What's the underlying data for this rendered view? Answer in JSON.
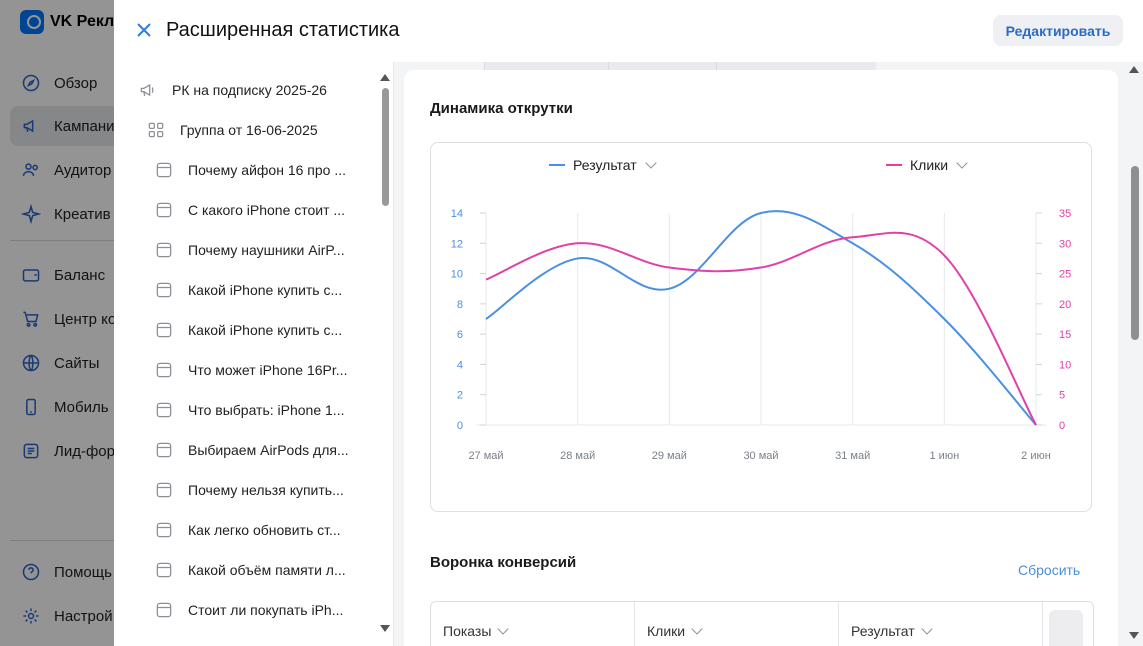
{
  "app": {
    "name": "VK Рекл",
    "nav": [
      {
        "label": "Обзор",
        "icon": "compass-icon"
      },
      {
        "label": "Кампани",
        "icon": "megaphone-icon",
        "active": true
      },
      {
        "label": "Аудитор",
        "icon": "users-icon"
      },
      {
        "label": "Креатив",
        "icon": "sparkle-icon"
      },
      {
        "label": "Баланс",
        "icon": "wallet-icon"
      },
      {
        "label": "Центр ко",
        "icon": "cart-icon"
      },
      {
        "label": "Сайты",
        "icon": "globe-icon"
      },
      {
        "label": "Мобиль",
        "icon": "phone-icon"
      },
      {
        "label": "Лид-фор",
        "icon": "list-icon"
      },
      {
        "label": "Помощь",
        "icon": "help-icon"
      },
      {
        "label": "Настрой",
        "icon": "settings-icon"
      }
    ]
  },
  "panel": {
    "title": "Расширенная статистика",
    "edit_label": "Редактировать"
  },
  "tree": {
    "campaign": "РК на подписку 2025-26",
    "group": "Группа от 16-06-2025",
    "ads": [
      "Почему айфон 16 про ...",
      "С какого iPhone стоит ...",
      "Почему наушники AirP...",
      "Какой iPhone купить с...",
      "Какой iPhone купить с...",
      "Что может iPhone 16Pr...",
      "Что выбрать: iPhone 1...",
      "Выбираем AirPods для...",
      "Почему нельзя купить...",
      "Как легко обновить ст...",
      "Какой объём памяти л...",
      "Стоит ли покупать iPh..."
    ]
  },
  "dynamics": {
    "title": "Динамика открутки"
  },
  "chart_data": {
    "type": "line",
    "categories": [
      "27 май",
      "28 май",
      "29 май",
      "30 май",
      "31 май",
      "1 июн",
      "2 июн"
    ],
    "series": [
      {
        "name": "Результат",
        "axis": "left",
        "color": "#4a90e2",
        "values": [
          7,
          11,
          9,
          14,
          12,
          7,
          0
        ]
      },
      {
        "name": "Клики",
        "axis": "right",
        "color": "#e040a8",
        "values": [
          24,
          30,
          26,
          26,
          31,
          28,
          0
        ]
      }
    ],
    "y_left": {
      "ticks": [
        0,
        2,
        4,
        6,
        8,
        10,
        12,
        14
      ],
      "range": [
        0,
        14
      ]
    },
    "y_right": {
      "ticks": [
        0,
        5,
        10,
        15,
        20,
        25,
        30,
        35
      ],
      "range": [
        0,
        35
      ]
    },
    "grid": "vertical",
    "legend": "top"
  },
  "funnel": {
    "title": "Воронка конверсий",
    "reset_label": "Сбросить",
    "columns": [
      "Показы",
      "Клики",
      "Результат"
    ]
  },
  "colors": {
    "accent": "#2a7be4",
    "series_left": "#4a90e2",
    "series_right": "#e040a8"
  }
}
